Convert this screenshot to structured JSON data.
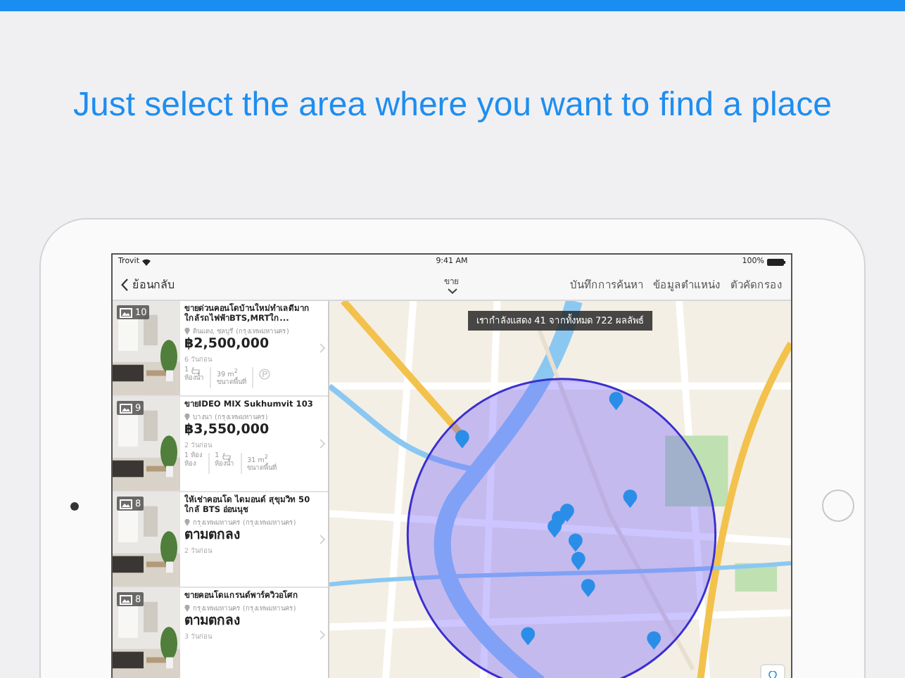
{
  "headline": "Just select the area where you want to find a place",
  "status_bar": {
    "carrier": "Trovit",
    "time": "9:41 AM",
    "battery": "100%"
  },
  "nav": {
    "back": "ย้อนกลับ",
    "title": "ขาย",
    "actions": [
      "บันทึกการค้นหา",
      "ข้อมูลตำแหน่ง",
      "ตัวคัดกรอง"
    ]
  },
  "listings": [
    {
      "photo_count": "10",
      "title": "ขายด่วนคอนโดบ้านใหม่ทำเลดีมากใกล้รถไฟฟ้าBTS,MRTใก...",
      "location": "ดินแดง, ชลบุรี (กรุงเทพมหานคร)",
      "price": "฿2,500,000",
      "age": "6 วันก่อน",
      "features": [
        {
          "kind": "bath",
          "value": "1",
          "label": "ห้องน้ำ"
        },
        {
          "kind": "area",
          "value": "39 m$^{2}$",
          "label": "ขนาดพื้นที่"
        },
        {
          "kind": "parking"
        }
      ]
    },
    {
      "photo_count": "9",
      "title": "ขายIDEO MIX Sukhumvit 103",
      "location": "บางนา (กรุงเทพมหานคร)",
      "price": "฿3,550,000",
      "age": "2 วันก่อน",
      "features": [
        {
          "kind": "rooms",
          "value": "1 ห้อง",
          "label": "ห้อง"
        },
        {
          "kind": "bath",
          "value": "1",
          "label": "ห้องน้ำ"
        },
        {
          "kind": "area",
          "value": "31 m$^{2}$",
          "label": "ขนาดพื้นที่"
        }
      ]
    },
    {
      "photo_count": "8",
      "title": "ให้เช่าคอนโด ไดมอนด์ สุขุมวิท 50 ใกล้ BTS อ่อนนุช",
      "location": "กรุงเทพมหานคร (กรุงเทพมหานคร)",
      "price": "ตามตกลง",
      "age": "2 วันก่อน"
    },
    {
      "photo_count": "8",
      "title": "ขายคอนโดแกรนด์พาร์ควิวอโศก",
      "location": "กรุงเทพมหานคร (กรุงเทพมหานคร)",
      "price": "ตามตกลง",
      "age": "3 วันก่อน"
    }
  ],
  "map": {
    "kind": "picture",
    "results_toast": "เรากำลังแสดง 41 จากทั้งหมด 722 ผลลัพธ์"
  }
}
